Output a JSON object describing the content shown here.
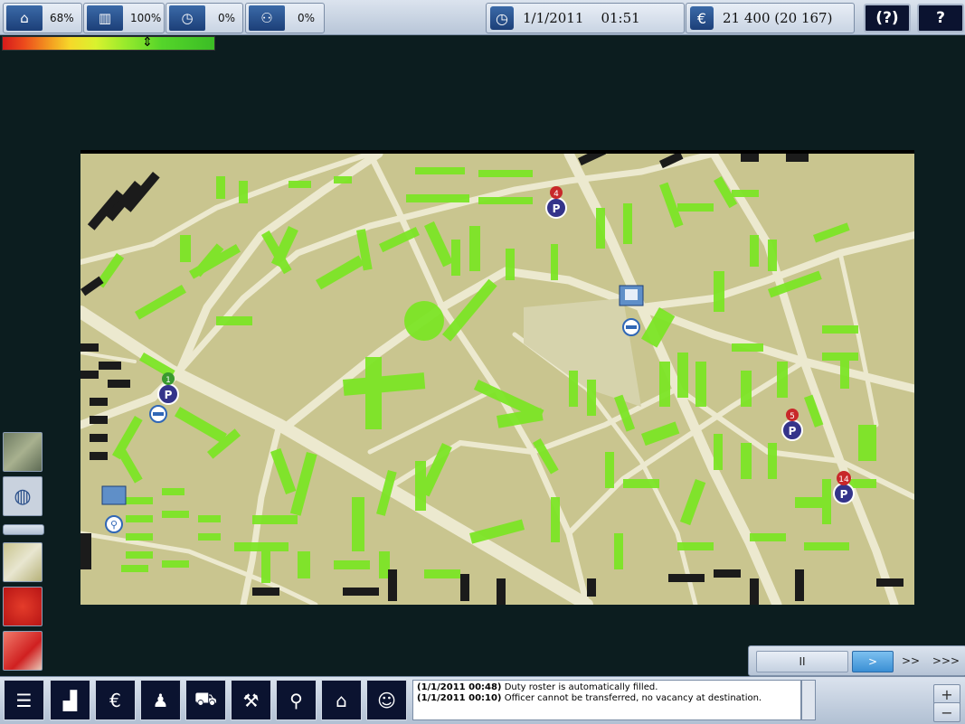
{
  "topbar": {
    "stats": [
      {
        "icon": "housing-icon",
        "value": "68%"
      },
      {
        "icon": "industry-icon",
        "value": "100%"
      },
      {
        "icon": "clock-worker-icon",
        "value": "0%"
      },
      {
        "icon": "traffic-icon",
        "value": "0%"
      }
    ],
    "datetime": {
      "icon": "clock-icon",
      "text": "1/1/2011    01:51"
    },
    "money": {
      "icon": "euro-icon",
      "text": "21 400 (20 167)"
    },
    "help_label": "(?)",
    "question_label": "?"
  },
  "gradient": {
    "marker_value": 0.68
  },
  "map": {
    "markers": [
      {
        "type": "parking",
        "count": "4",
        "color": "#c8282a"
      },
      {
        "type": "parking",
        "count": "1",
        "color": "#3a9a2f"
      },
      {
        "type": "parking",
        "count": "5",
        "color": "#c8282a"
      },
      {
        "type": "parking",
        "count": "14",
        "color": "#c8282a"
      }
    ]
  },
  "speed": {
    "pause_label": "II",
    "play_label": ">",
    "fast_label": ">>",
    "faster_label": ">>>"
  },
  "log": {
    "messages": [
      {
        "time": "(1/1/2011 00:48)",
        "text": " Duty roster is automatically filled."
      },
      {
        "time": "(1/1/2011 00:10)",
        "text": " Officer cannot be transferred, no vacancy at destination."
      }
    ]
  },
  "zoom": {
    "plus": "+",
    "minus": "−"
  },
  "colors": {
    "accent": "#1c3f78",
    "building": "#7de526",
    "building_dark": "#1b1b1b",
    "map_bg": "#c9c58f"
  }
}
